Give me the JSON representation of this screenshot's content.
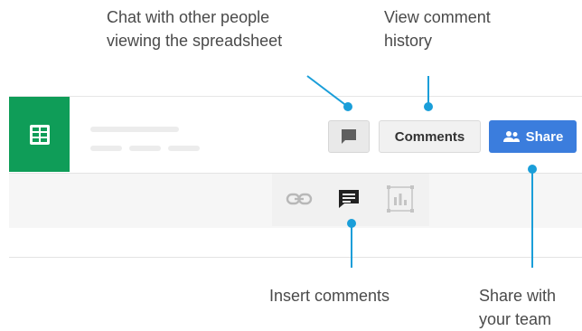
{
  "callouts": {
    "chat": "Chat with other people\nviewing the spreadsheet",
    "history": "View comment\nhistory",
    "insert": "Insert comments",
    "share": "Share with\nyour team"
  },
  "header": {
    "comments_label": "Comments",
    "share_label": "Share"
  },
  "icons": {
    "logo": "sheets-logo-icon",
    "chat": "chat-bubble-icon",
    "share": "people-icon",
    "link": "link-icon",
    "insert_comment": "comment-icon",
    "chart": "chart-icon"
  },
  "colors": {
    "sheets_green": "#0f9d58",
    "share_blue": "#3b7ddd",
    "callout_line": "#1a9ed9"
  }
}
